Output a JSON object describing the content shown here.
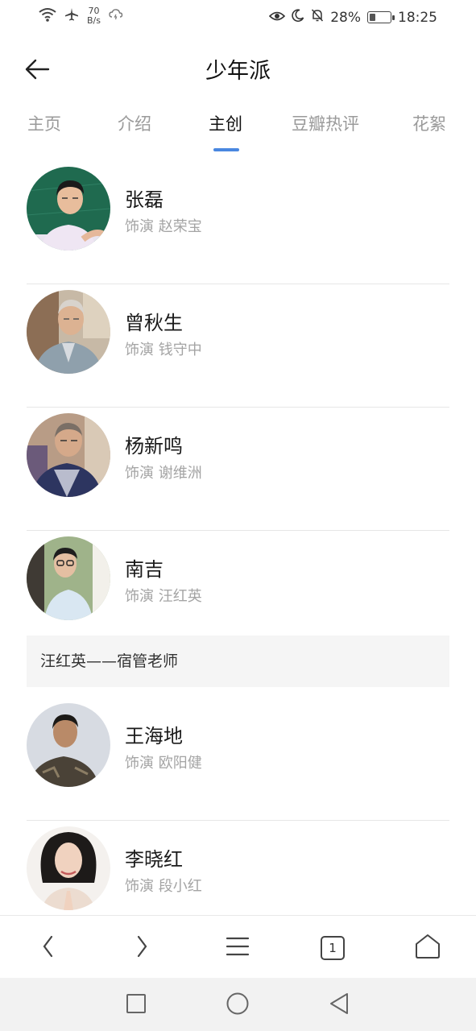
{
  "status": {
    "net_speed_value": "70",
    "net_speed_unit": "B/s",
    "battery_percent": "28%",
    "battery_level": 0.28,
    "time": "18:25"
  },
  "header": {
    "title": "少年派"
  },
  "tabs": [
    {
      "label": "主页",
      "active": false
    },
    {
      "label": "介绍",
      "active": false
    },
    {
      "label": "主创",
      "active": true
    },
    {
      "label": "豆瓣热评",
      "active": false
    },
    {
      "label": "花絮",
      "active": false
    }
  ],
  "cast": [
    {
      "name": "张磊",
      "role": "饰演 赵荣宝"
    },
    {
      "name": "曾秋生",
      "role": "饰演 钱守中"
    },
    {
      "name": "杨新鸣",
      "role": "饰演 谢维洲"
    },
    {
      "name": "南吉",
      "role": "饰演 汪红英",
      "note": "汪红英——宿管老师"
    },
    {
      "name": "王海地",
      "role": "饰演 欧阳健"
    },
    {
      "name": "李晓红",
      "role": "饰演 段小红"
    }
  ],
  "browser_toolbar": {
    "tab_count": "1"
  },
  "icons": {
    "back": "arrow-left-icon",
    "browser_back": "chevron-left-icon",
    "browser_forward": "chevron-right-icon",
    "menu": "menu-icon",
    "tabs": "tabs-icon",
    "home": "home-icon",
    "recents": "square-icon",
    "sys_home": "circle-icon",
    "sys_back": "triangle-back-icon"
  },
  "colors": {
    "accent": "#4a87e0",
    "tab_inactive": "#9a9a9a",
    "role_text": "#a4a4a4",
    "note_bg": "#f5f5f5"
  }
}
